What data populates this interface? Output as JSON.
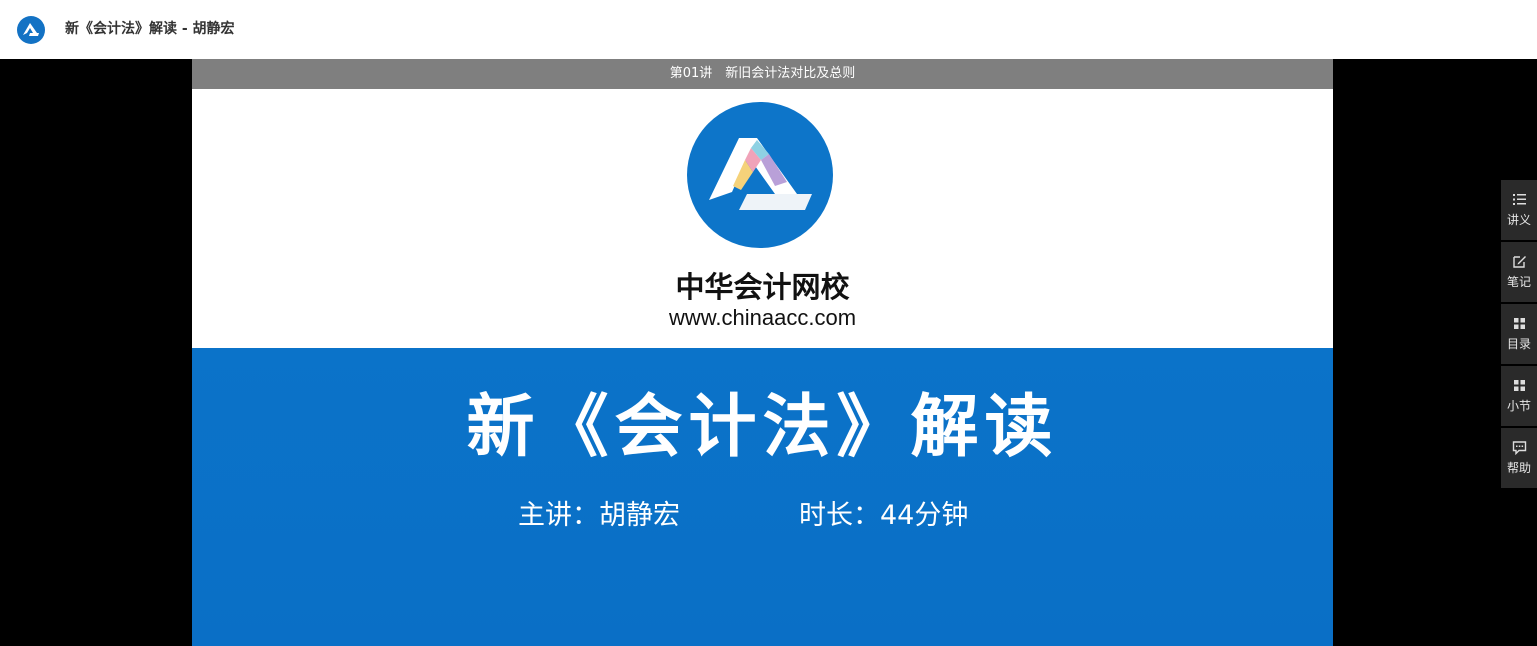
{
  "header": {
    "logo_icon": "chinaacc-logo-icon",
    "title": "新《会计法》解读 - 胡静宏"
  },
  "player": {
    "lecture_title": "第01讲　新旧会计法对比及总则",
    "slide": {
      "brand_name": "中华会计网校",
      "brand_url": "www.chinaacc.com",
      "course_title": "新《会计法》解读",
      "presenter": "主讲：胡静宏",
      "duration": "时长：44分钟"
    }
  },
  "sidebar": {
    "items": [
      {
        "label": "讲义",
        "icon": "list-icon"
      },
      {
        "label": "笔记",
        "icon": "edit-icon"
      },
      {
        "label": "目录",
        "icon": "grid-icon"
      },
      {
        "label": "小节",
        "icon": "grid-icon"
      },
      {
        "label": "帮助",
        "icon": "chat-icon"
      }
    ]
  },
  "colors": {
    "brand_blue": "#0a6fc6",
    "lecture_bar": "#7f7f7f",
    "sidebar_bg": "#2a2a2a"
  }
}
